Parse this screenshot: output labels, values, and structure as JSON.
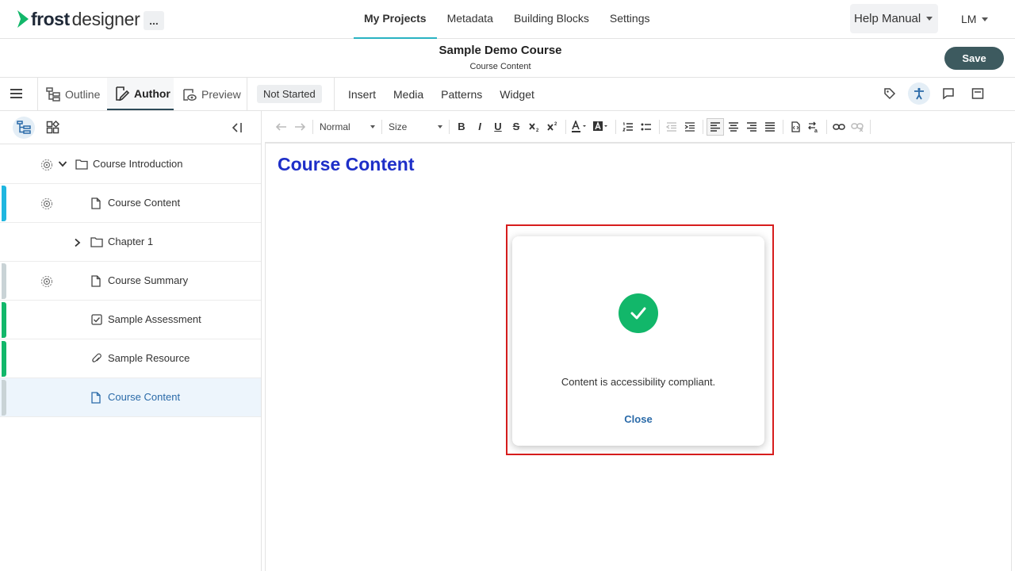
{
  "app": {
    "logo_bold": "frost",
    "logo_light": "designer",
    "more_label": "...",
    "brand_color": "#12b76a"
  },
  "topnav": [
    {
      "label": "My Projects",
      "active": true
    },
    {
      "label": "Metadata"
    },
    {
      "label": "Building Blocks"
    },
    {
      "label": "Settings"
    }
  ],
  "help": {
    "label": "Help Manual"
  },
  "user": {
    "initials": "LM"
  },
  "course": {
    "title": "Sample Demo Course",
    "subtitle": "Course Content",
    "save_label": "Save"
  },
  "modes": {
    "outline": "Outline",
    "author": "Author",
    "preview": "Preview",
    "status": "Not Started"
  },
  "insert_menu": [
    "Insert",
    "Media",
    "Patterns",
    "Widget"
  ],
  "tree": [
    {
      "label": "Course Introduction",
      "icon": "folder-icon",
      "gear": true,
      "chevron": "down",
      "bar": null
    },
    {
      "label": "Course Content",
      "icon": "page-icon",
      "gear": true,
      "bar": "#1fb6e0"
    },
    {
      "label": "Chapter 1",
      "icon": "folder-icon",
      "chevron": "right",
      "bar": null
    },
    {
      "label": "Course Summary",
      "icon": "page-icon",
      "gear": true,
      "bar": "#c9d3d6"
    },
    {
      "label": "Sample Assessment",
      "icon": "checkbox-icon",
      "bar": "#12b76a"
    },
    {
      "label": "Sample Resource",
      "icon": "paperclip-icon",
      "bar": "#12b76a"
    },
    {
      "label": "Course Content",
      "icon": "page-icon",
      "bar": "#c9d3d6",
      "selected": true
    }
  ],
  "editor": {
    "format_select": "Normal",
    "size_select": "Size",
    "heading": "Course Content",
    "heading_color": "#1e2fc8",
    "bold": "B",
    "italic": "I",
    "underline": "U",
    "strike": "S"
  },
  "modal": {
    "message": "Content is accessibility compliant.",
    "close_label": "Close",
    "highlight_color": "#d71d1d"
  }
}
